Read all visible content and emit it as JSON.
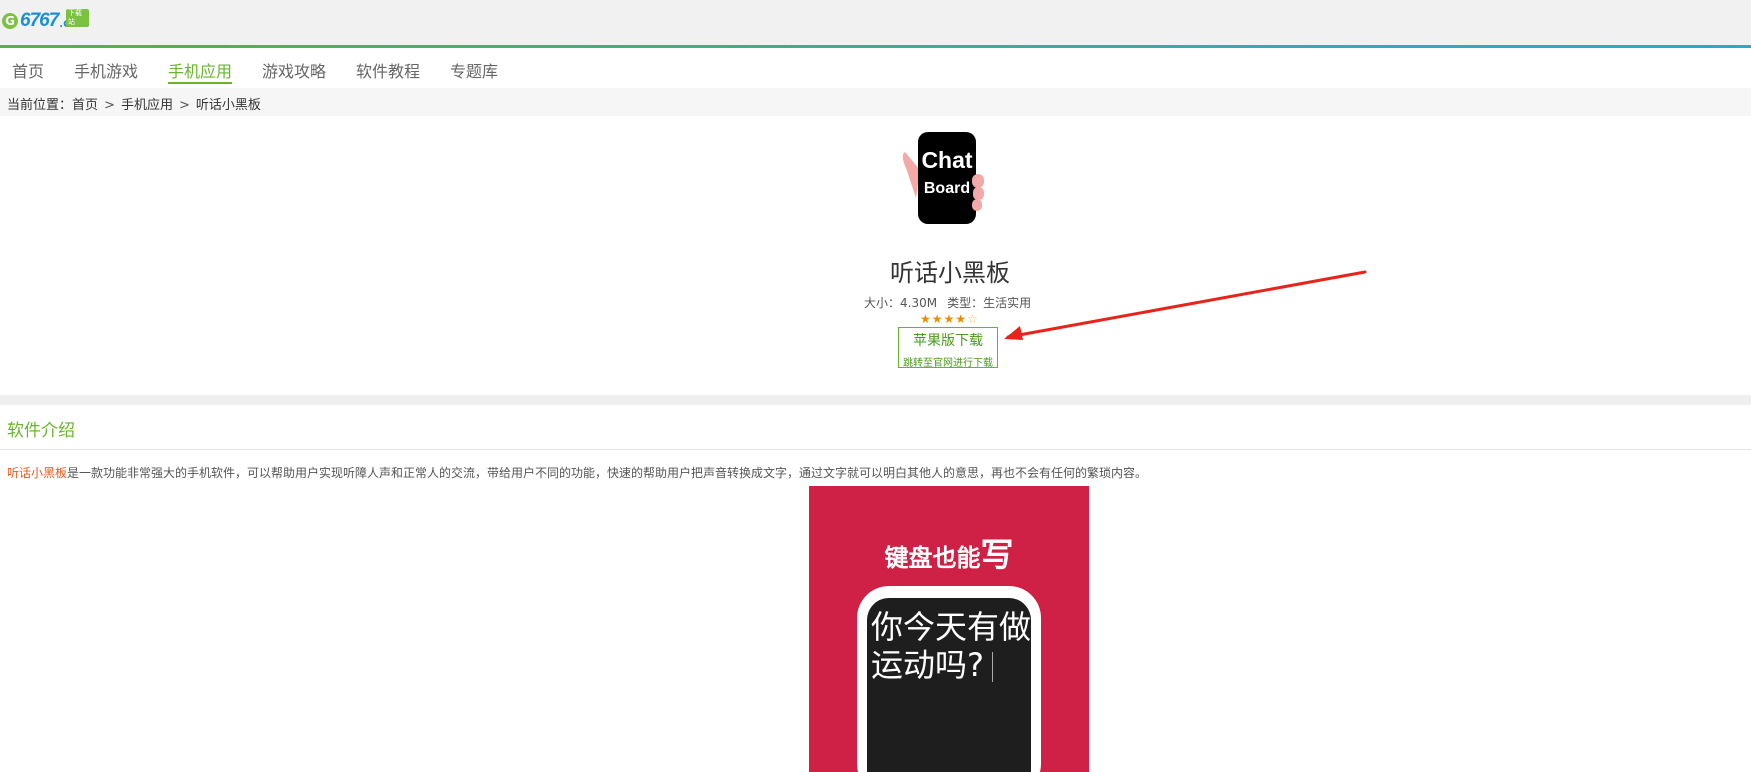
{
  "site": {
    "logo_mark": "G",
    "logo_text": "6767",
    "logo_suffix": ".COM",
    "logo_badge": "下载站"
  },
  "nav": {
    "items": [
      {
        "label": "首页",
        "active": false
      },
      {
        "label": "手机游戏",
        "active": false
      },
      {
        "label": "手机应用",
        "active": true
      },
      {
        "label": "游戏攻略",
        "active": false
      },
      {
        "label": "软件教程",
        "active": false
      },
      {
        "label": "专题库",
        "active": false
      }
    ]
  },
  "breadcrumb": {
    "prefix": "当前位置：",
    "items": [
      "首页",
      "手机应用",
      "听话小黑板"
    ],
    "separator": ">"
  },
  "app": {
    "icon_text_line1": "Chat",
    "icon_text_line2": "Board",
    "title": "听话小黑板",
    "size_label": "大小：4.30M",
    "type_label": "类型：生活实用",
    "rating": 4,
    "rating_max": 5,
    "stars_filled": "★★★★",
    "stars_empty": "☆",
    "download_label": "苹果版下载",
    "download_sub": "跳转至官网进行下载"
  },
  "intro": {
    "section_title": "软件介绍",
    "highlight": "听话小黑板",
    "text": "是一款功能非常强大的手机软件，可以帮助用户实现听障人声和正常人的交流，带给用户不同的功能，快速的帮助用户把声音转换成文字，通过文字就可以明白其他人的意思，再也不会有任何的繁琐内容。"
  },
  "promo": {
    "headline": "键盘也能",
    "headline_big": "写",
    "screen_line1": "你今天有做",
    "screen_line2": "运动吗?"
  },
  "colors": {
    "accent_green": "#6ab42c",
    "highlight_orange": "#e85c1e",
    "promo_red": "#cf2045",
    "arrow_red": "#e8231b"
  }
}
